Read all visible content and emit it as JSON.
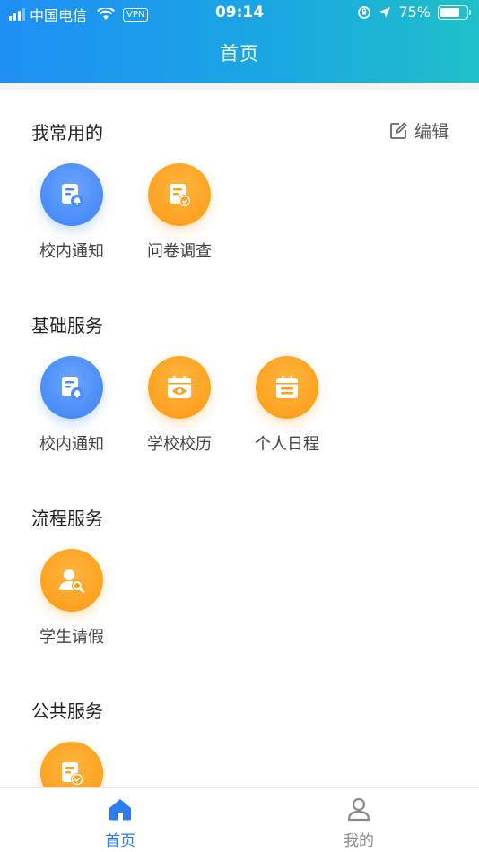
{
  "status_bar": {
    "carrier": "中国电信",
    "vpn": "VPN",
    "time": "09:14",
    "battery": "75%",
    "battery_level": 0.75
  },
  "header": {
    "title": "首页"
  },
  "sections": {
    "favorites": {
      "title": "我常用的",
      "edit_label": "编辑",
      "items": [
        {
          "label": "校内通知",
          "icon": "notice-bell-icon",
          "color": "#3c82f6"
        },
        {
          "label": "问卷调查",
          "icon": "survey-check-icon",
          "color": "#ff9a12"
        }
      ]
    },
    "basic": {
      "title": "基础服务",
      "items": [
        {
          "label": "校内通知",
          "icon": "notice-bell-icon",
          "color": "#3c82f6"
        },
        {
          "label": "学校校历",
          "icon": "calendar-eye-icon",
          "color": "#ff9a12"
        },
        {
          "label": "个人日程",
          "icon": "calendar-list-icon",
          "color": "#ff9a12"
        }
      ]
    },
    "process": {
      "title": "流程服务",
      "items": [
        {
          "label": "学生请假",
          "icon": "user-search-icon",
          "color": "#ff9a12"
        }
      ]
    },
    "public": {
      "title": "公共服务",
      "items": [
        {
          "label": "",
          "icon": "survey-check-icon",
          "color": "#ff9a12"
        }
      ]
    }
  },
  "tabbar": {
    "home_label": "首页",
    "mine_label": "我的",
    "active_color": "#2d7cf0",
    "inactive_color": "#8a8a8a"
  }
}
